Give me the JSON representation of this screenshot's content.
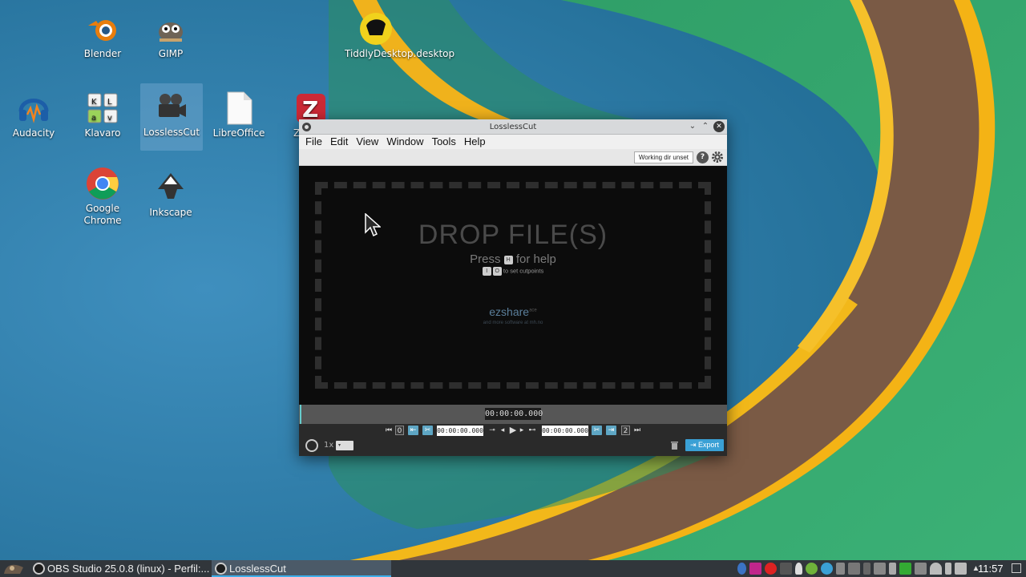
{
  "desktop": {
    "icons": [
      {
        "label": "Blender"
      },
      {
        "label": "GIMP"
      },
      {
        "label": "TiddlyDesktop.desktop"
      },
      {
        "label": "Audacity"
      },
      {
        "label": "Klavaro"
      },
      {
        "label": "LosslessCut"
      },
      {
        "label": "LibreOffice"
      },
      {
        "label": "Z"
      },
      {
        "label": "Google Chrome"
      },
      {
        "label": "Inkscape"
      }
    ]
  },
  "window": {
    "title": "LosslessCut",
    "menu": [
      "File",
      "Edit",
      "View",
      "Window",
      "Tools",
      "Help"
    ],
    "toolbar": {
      "workdir_label": "Working dir unset",
      "help_label": "?"
    },
    "drop": {
      "title": "DROP FILE(S)",
      "press": "Press",
      "help_key": "H",
      "for_help": "for help",
      "key_in": "I",
      "key_out": "O",
      "cutpoints_text": "to set cutpoints",
      "brand": "ezshare",
      "brand_sup": "ace",
      "brand_sub": "and more software at mh.no"
    },
    "timeline": {
      "current_time": "00:00:00.000"
    },
    "controls": {
      "start_time": "00:00:00.000",
      "end_time": "00:00:00.000",
      "cut_start_index": "0",
      "cut_end_index": "2",
      "speed": "1x",
      "export_label": "Export"
    }
  },
  "taskbar": {
    "tasks": [
      {
        "label": "OBS Studio 25.0.8 (linux) - Perfil:..."
      },
      {
        "label": "LosslessCut"
      }
    ],
    "clock": "11:57"
  },
  "colors": {
    "accent": "#3daee9",
    "export": "#3aa0d5",
    "taskbar": "#31363b"
  }
}
